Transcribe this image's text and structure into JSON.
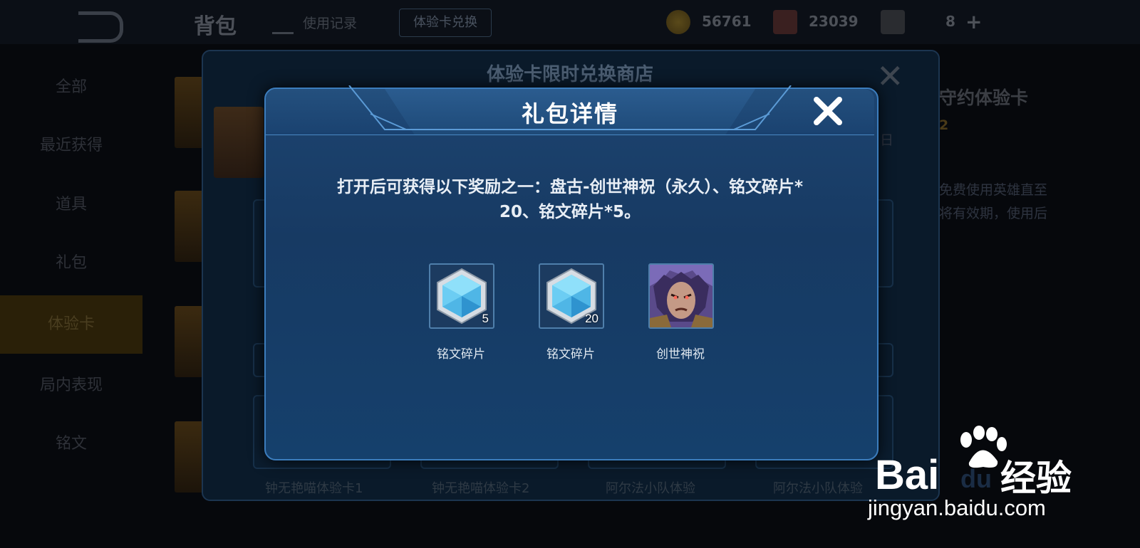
{
  "background": {
    "title": "背包",
    "tab_use_record": "使用记录",
    "exchange_button": "体验卡兑换",
    "currency": [
      {
        "icon": "gold-coin-icon",
        "value": "56761"
      },
      {
        "icon": "diamond-icon",
        "value": "23039"
      },
      {
        "icon": "ticket-icon",
        "value": "8"
      }
    ],
    "sidebar": [
      "全部",
      "最近获得",
      "道具",
      "礼包",
      "体验卡",
      "局内表现",
      "铭文"
    ],
    "shop_title": "体验卡限时兑换商店",
    "detail_title": "守约体验卡",
    "detail_count": "2",
    "detail_day": "日",
    "detail_desc": [
      "免费使用英雄直至",
      "将有效期，使用后"
    ],
    "shop_items": [
      "钟无艳喵体验卡1",
      "钟无艳喵体验卡2",
      "阿尔法小队体验",
      "阿尔法小队体验"
    ]
  },
  "dialog": {
    "title": "礼包详情",
    "description_line1": "打开后可获得以下奖励之一：盘古-创世神祝（永久）、铭文碎片*",
    "description_line2": "20、铭文碎片*5。",
    "items": [
      {
        "label": "铭文碎片",
        "count": "5",
        "icon": "inscription-shard-icon"
      },
      {
        "label": "铭文碎片",
        "count": "20",
        "icon": "inscription-shard-icon"
      },
      {
        "label": "创世神祝",
        "count": "",
        "icon": "pangu-skin-portrait"
      }
    ]
  },
  "watermark": {
    "brand": "Bai",
    "brand_suffix": "du",
    "product": "经验",
    "url": "jingyan.baidu.com"
  },
  "colors": {
    "dialog_bg": "#173a63",
    "dialog_border": "#3c7dbd",
    "shard_blue": "#5ec8f2"
  }
}
